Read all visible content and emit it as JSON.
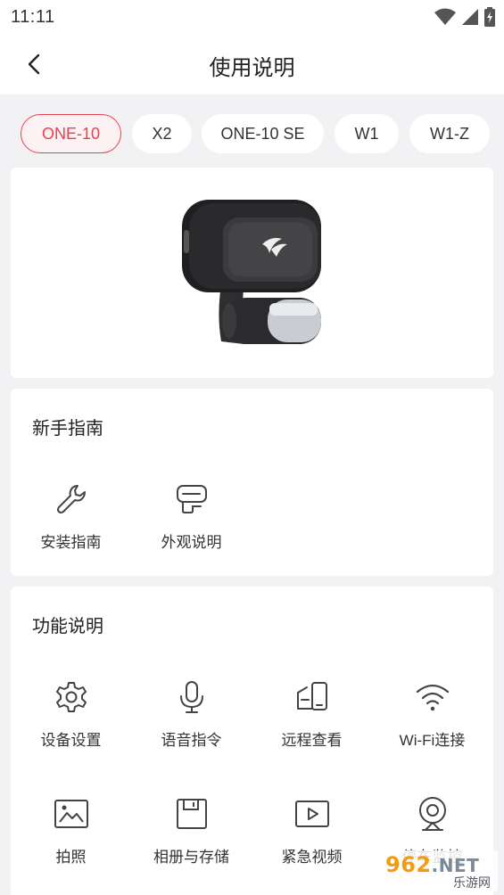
{
  "status_bar": {
    "time": "11:11"
  },
  "header": {
    "title": "使用说明",
    "back_icon": "chevron-left-icon"
  },
  "tabs": [
    {
      "label": "ONE-10",
      "active": true
    },
    {
      "label": "X2",
      "active": false
    },
    {
      "label": "ONE-10 SE",
      "active": false
    },
    {
      "label": "W1",
      "active": false
    },
    {
      "label": "W1-Z",
      "active": false
    }
  ],
  "accent_color": "#e8414f",
  "guide": {
    "title": "新手指南",
    "items": [
      {
        "label": "安装指南",
        "icon": "wrench-icon"
      },
      {
        "label": "外观说明",
        "icon": "device-outline-icon"
      }
    ]
  },
  "functions": {
    "title": "功能说明",
    "items": [
      {
        "label": "设备设置",
        "icon": "gear-icon"
      },
      {
        "label": "语音指令",
        "icon": "microphone-icon"
      },
      {
        "label": "远程查看",
        "icon": "remote-phone-icon"
      },
      {
        "label": "Wi-Fi连接",
        "icon": "wifi-icon"
      },
      {
        "label": "拍照",
        "icon": "image-icon"
      },
      {
        "label": "相册与存储",
        "icon": "save-icon"
      },
      {
        "label": "紧急视频",
        "icon": "play-video-icon"
      },
      {
        "label": "停车监控",
        "icon": "webcam-icon"
      }
    ]
  },
  "watermark": {
    "main": "962",
    "net": ".NET",
    "sub": "乐游网"
  }
}
